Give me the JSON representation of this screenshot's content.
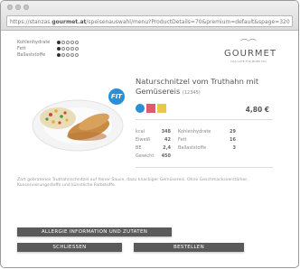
{
  "browser": {
    "url_prefix": "https://stanzas.",
    "url_domain": "gourmet.at",
    "url_rest": "/speisenauswahl/menu?ProductDetails=70&premium=default&spage=320"
  },
  "filters": [
    {
      "label": "Kohlenhydrate",
      "level": 1,
      "max": 5
    },
    {
      "label": "Fett",
      "level": 1,
      "max": 5
    },
    {
      "label": "Ballaststoffe",
      "level": 1,
      "max": 5
    }
  ],
  "brand": {
    "name": "GOURMET",
    "mark": "⌒⌒",
    "tagline": "DAS GUTE FÜR JEDEN TAG"
  },
  "product": {
    "name": "Naturschnitzel vom Truthahn mit Gemüsereis",
    "code": "(12345)",
    "badge_label": "FIT",
    "price": "4,80 €"
  },
  "nutrition": [
    {
      "label": "kcal",
      "value": "348",
      "label2": "Kohlenhydrate",
      "value2": "29"
    },
    {
      "label": "Eiweiß",
      "value": "42",
      "label2": "Fett",
      "value2": "16"
    },
    {
      "label": "BE",
      "value": "2,4",
      "label2": "Ballaststoffe",
      "value2": "3"
    },
    {
      "label": "Gewicht",
      "value": "450",
      "label2": "",
      "value2": ""
    }
  ],
  "description": "Zart gebratenes Truthahnschnitzel auf feiner Sauce, dazu knackiger Gemüsereis. Ohne Geschmacksverstärker, Konservierungsstoffe und künstliche Farbstoffe.",
  "buttons": {
    "allergy": "ALLERGIE INFORMATION UND ZUTATEN",
    "close": "SCHLIESSEN",
    "order": "BESTELLEN"
  }
}
